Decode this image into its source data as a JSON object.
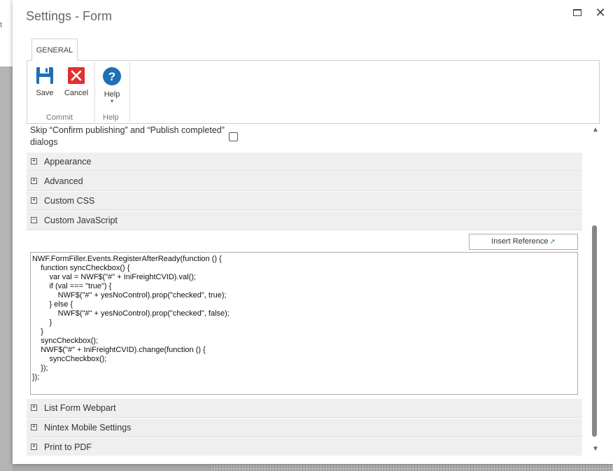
{
  "background": {
    "glyph": "t"
  },
  "dialog": {
    "title": "Settings - Form",
    "maximize_icon": "maximize-icon",
    "close_icon": "close-icon",
    "close_glyph": "✕"
  },
  "ribbon": {
    "tab": "GENERAL",
    "save_label": "Save",
    "cancel_label": "Cancel",
    "help_label": "Help",
    "help_glyph": "?",
    "help_dropdown": "▾",
    "group_commit": "Commit",
    "group_help": "Help"
  },
  "form": {
    "skip_label": "Skip “Confirm publishing” and “Publish completed” dialogs",
    "skip_checked": false,
    "sections_top": [
      {
        "label": "Appearance",
        "toggle": "+"
      },
      {
        "label": "Advanced",
        "toggle": "+"
      },
      {
        "label": "Custom CSS",
        "toggle": "+"
      },
      {
        "label": "Custom JavaScript",
        "toggle": "−"
      }
    ],
    "insert_reference": "Insert Reference",
    "code": "NWF.FormFiller.Events.RegisterAfterReady(function () {\n    function syncCheckbox() {\n        var val = NWF$(\"#\" + IniFreightCVID).val();\n        if (val === \"true\") {\n            NWF$(\"#\" + yesNoControl).prop(\"checked\", true);\n        } else {\n            NWF$(\"#\" + yesNoControl).prop(\"checked\", false);\n        }\n    }\n    syncCheckbox();\n    NWF$(\"#\" + IniFreightCVID).change(function () {\n        syncCheckbox();\n    });\n});",
    "sections_bottom": [
      {
        "label": "List Form Webpart",
        "toggle": "+"
      },
      {
        "label": "Nintex Mobile Settings",
        "toggle": "+"
      },
      {
        "label": "Print to PDF",
        "toggle": "+"
      }
    ]
  },
  "scrollbar": {
    "up": "▲",
    "down": "▼",
    "position_fraction": 0.31
  },
  "colors": {
    "save_icon": "#1e6fb5",
    "cancel_icon": "#e03030",
    "help_icon": "#1e6fb5",
    "insert_arrow": "#2c9a3c"
  }
}
